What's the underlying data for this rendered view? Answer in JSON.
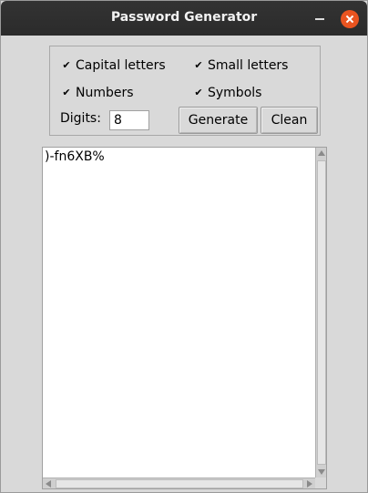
{
  "window": {
    "title": "Password Generator",
    "close_color": "#e95420"
  },
  "options": {
    "capital": {
      "label": "Capital letters",
      "checked": true
    },
    "small": {
      "label": "Small letters",
      "checked": true
    },
    "numbers": {
      "label": "Numbers",
      "checked": true
    },
    "symbols": {
      "label": "Symbols",
      "checked": true
    },
    "check_glyph": "✔",
    "digits_label": "Digits:",
    "digits_value": "8"
  },
  "buttons": {
    "generate": "Generate",
    "clean": "Clean"
  },
  "output": {
    "text": ")-fn6XB%"
  }
}
